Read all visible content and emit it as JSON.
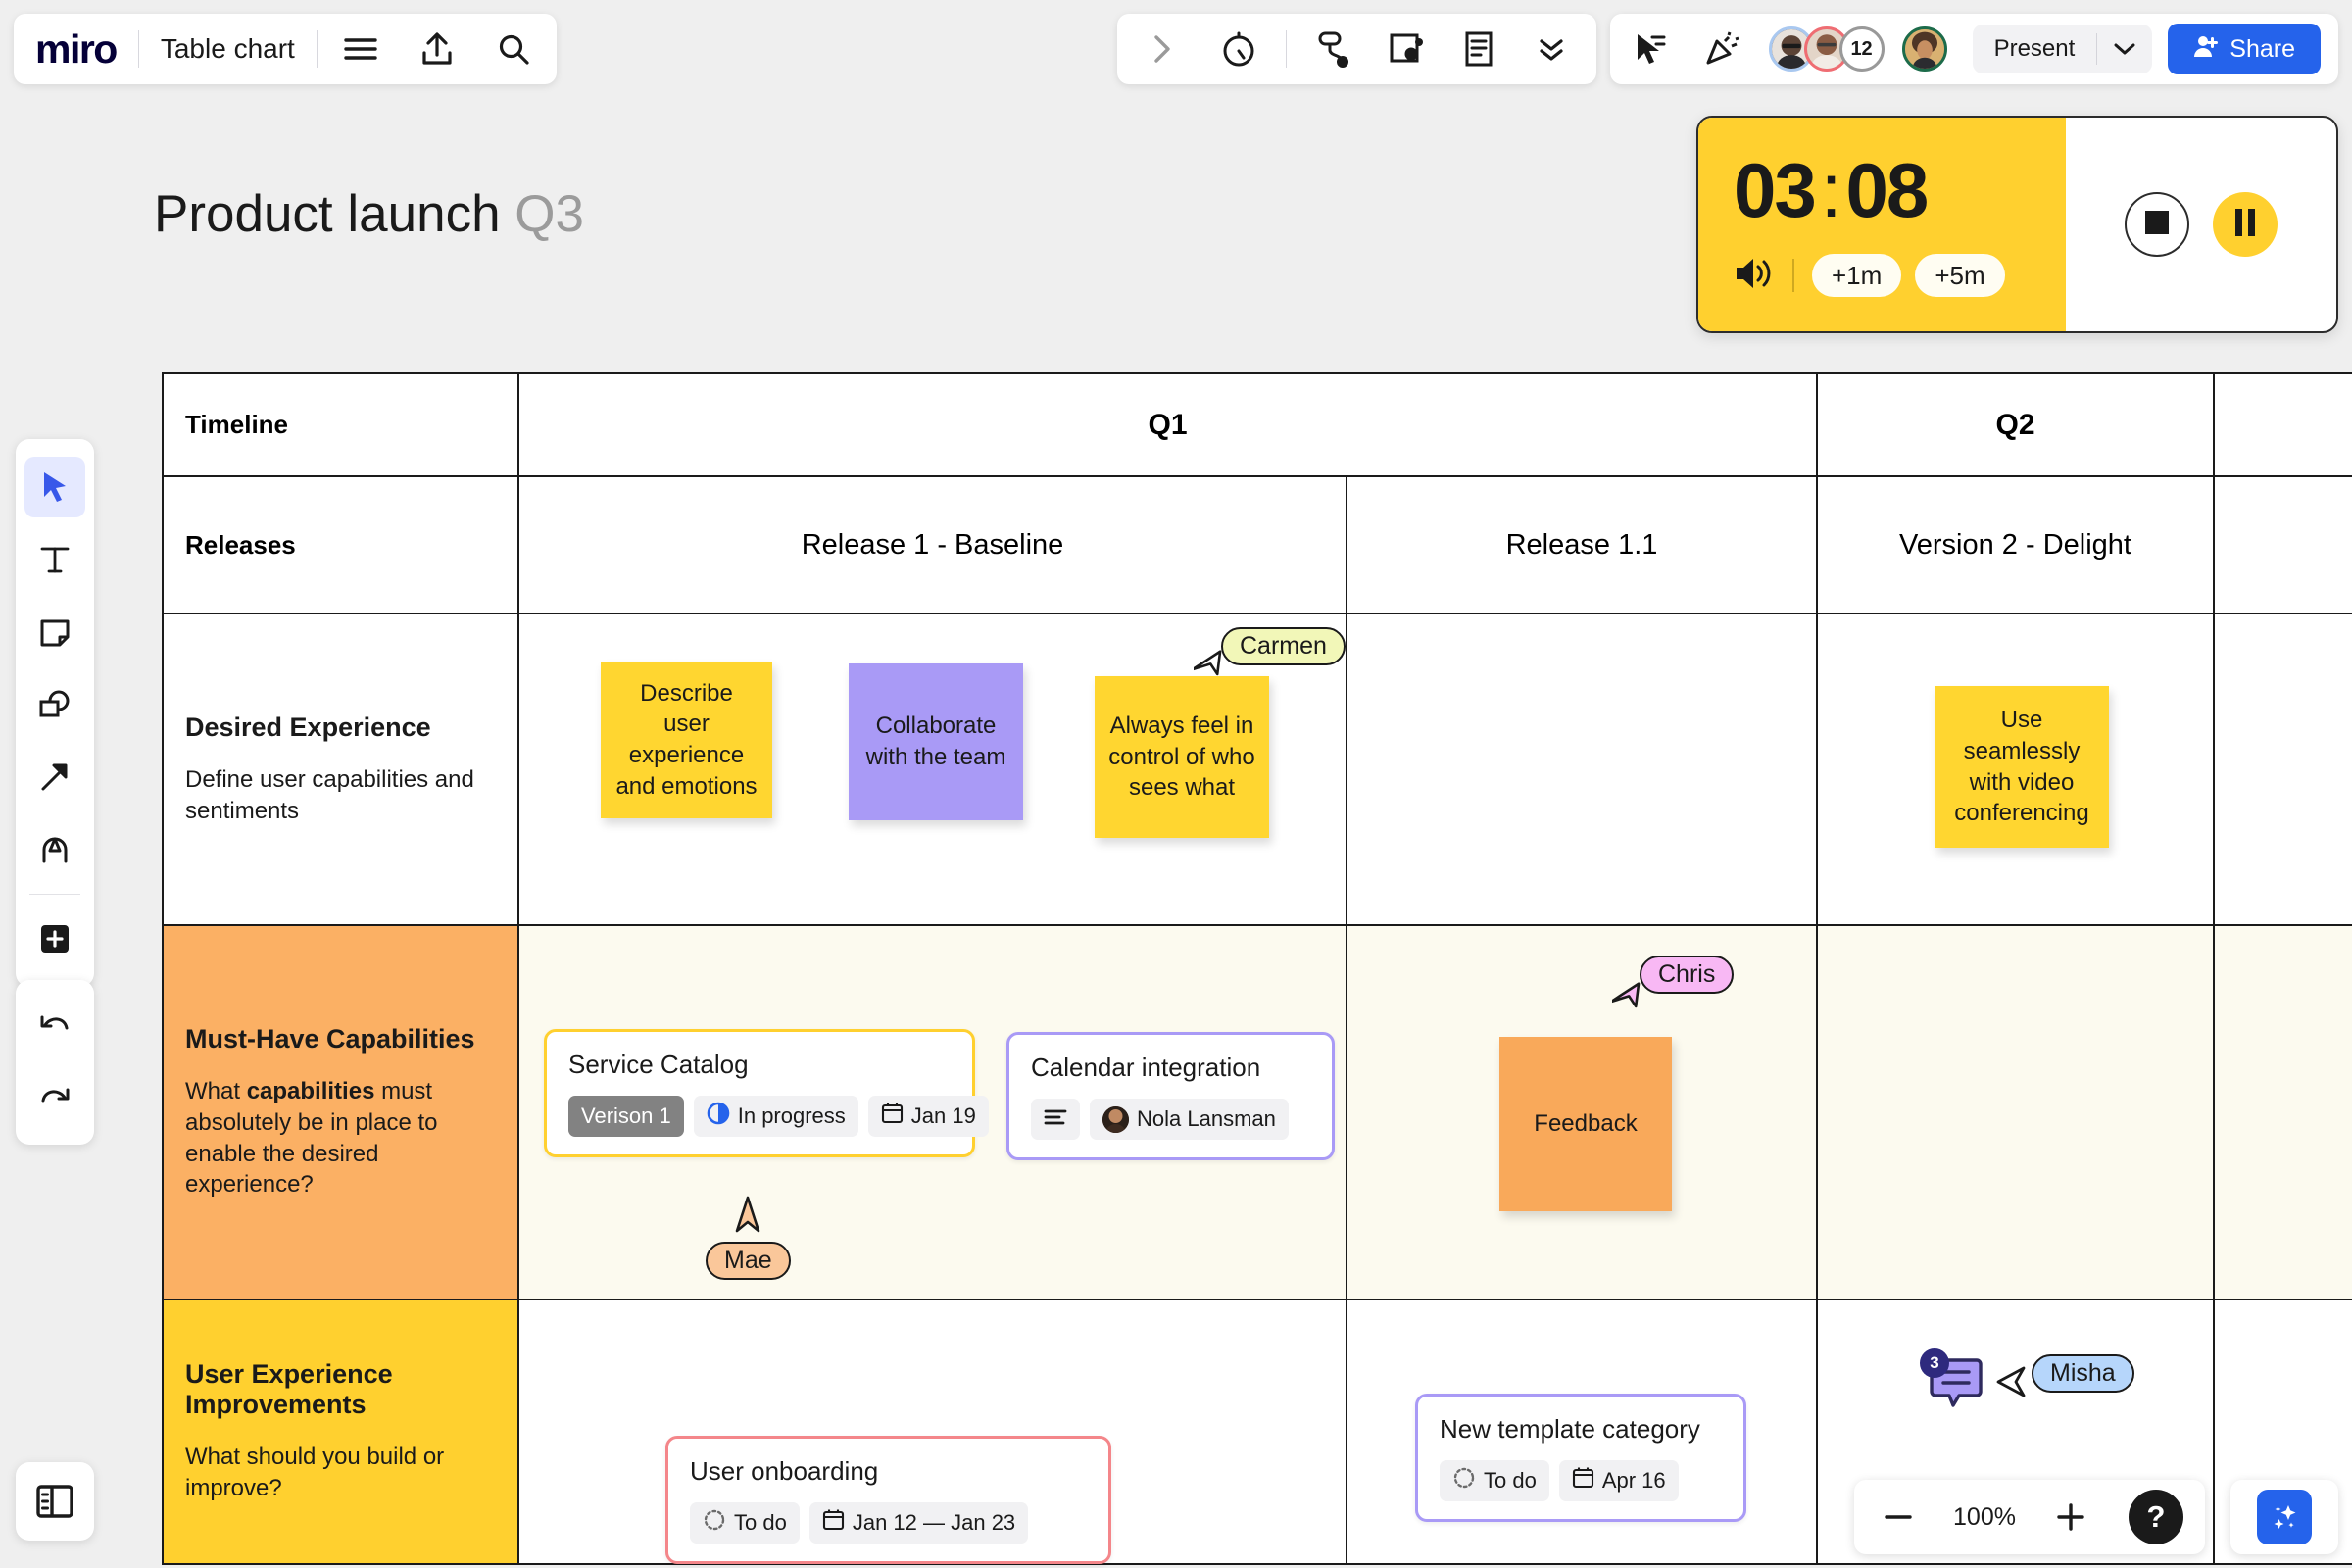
{
  "app": {
    "logo": "miro",
    "board_name": "Table chart",
    "menu_icon": "hamburger-menu-icon",
    "upload_icon": "upload-icon",
    "search_icon": "search-icon"
  },
  "toolbar_center": {
    "items": [
      {
        "name": "expand-chevron-right-icon",
        "label": ">"
      },
      {
        "name": "timer-icon",
        "label": "Timer"
      },
      {
        "name": "voting-icon",
        "label": "Voting"
      },
      {
        "name": "frames-icon",
        "label": "Frames"
      },
      {
        "name": "notes-icon",
        "label": "Notes"
      },
      {
        "name": "more-chevrons-down-icon",
        "label": "More"
      }
    ]
  },
  "toolbar_right": {
    "cursor_chat_icon": "cursor-chat-icon",
    "celebrate_icon": "celebrate-confetti-icon",
    "collaborator_count": "12",
    "present_label": "Present",
    "present_caret_icon": "chevron-down-icon",
    "share_label": "Share",
    "share_icon": "person-add-icon",
    "share_color": "#2563eb"
  },
  "timer": {
    "minutes": "03",
    "separator": ":",
    "seconds": "08",
    "sound_icon": "speaker-volume-icon",
    "add_1m": "+1m",
    "add_5m": "+5m",
    "stop_icon": "stop-square-icon",
    "pause_icon": "pause-icon",
    "accent": "#ffd02f"
  },
  "left_tools": {
    "items": [
      {
        "name": "select-cursor-tool",
        "label": "Select",
        "active": true
      },
      {
        "name": "text-tool",
        "label": "Text",
        "active": false
      },
      {
        "name": "sticky-note-tool",
        "label": "Sticky note",
        "active": false
      },
      {
        "name": "shapes-tool",
        "label": "Shapes",
        "active": false
      },
      {
        "name": "connector-arrow-tool",
        "label": "Connection line",
        "active": false
      },
      {
        "name": "pen-tool",
        "label": "Pen",
        "active": false
      },
      {
        "name": "more-apps-tool",
        "label": "More apps",
        "active": false
      }
    ],
    "undo_label": "Undo",
    "redo_label": "Redo",
    "panel_toggle_label": "Toggle panel"
  },
  "board": {
    "title_main": "Product launch",
    "title_suffix": "Q3"
  },
  "table": {
    "rows": [
      {
        "type": "header",
        "label": "Timeline",
        "cells": [
          {
            "text": "Q1",
            "span": 2
          },
          {
            "text": "Q2",
            "span": 1
          },
          {
            "text": "",
            "span": 1
          }
        ]
      },
      {
        "type": "releases",
        "label": "Releases",
        "cells": [
          {
            "text": "Release 1 - Baseline"
          },
          {
            "text": "Release 1.1"
          },
          {
            "text": "Version 2 - Delight"
          },
          {
            "text": ""
          }
        ]
      },
      {
        "type": "content",
        "label": "Desired Experience",
        "desc": "Define user capabilities and sentiments",
        "label_bg": "#ffffff",
        "row_bg": "#ffffff"
      },
      {
        "type": "content",
        "label": "Must-Have Capabilities",
        "desc_pre": "What ",
        "desc_bold": "capabilities",
        "desc_post": " must absolutely be in place to enable the desired experience?",
        "label_bg": "#fbb064",
        "row_bg": "#fcfaef"
      },
      {
        "type": "content",
        "label": "User Experience Improvements",
        "desc": "What should you build or improve?",
        "label_bg": "#ffd02f",
        "row_bg": "#ffffff"
      }
    ]
  },
  "stickies": [
    {
      "id": "s1",
      "text": "Describe user experience and emotions",
      "color": "#ffd630"
    },
    {
      "id": "s2",
      "text": "Collaborate with the team",
      "color": "#a99af6"
    },
    {
      "id": "s3",
      "text": "Always feel in control of who sees what",
      "color": "#ffd630"
    },
    {
      "id": "s4",
      "text": "Use seamlessly with video conferencing",
      "color": "#ffd630"
    },
    {
      "id": "s5",
      "text": "Feedback",
      "color": "#f9a košice"
    }
  ],
  "cards": [
    {
      "id": "c1",
      "title": "Service Catalog",
      "border": "#ffd02f",
      "chips": [
        {
          "name": "version-chip",
          "text": "Verison 1",
          "icon": null,
          "style": "grey"
        },
        {
          "name": "status-chip",
          "text": "In progress",
          "icon": "half-circle-progress-icon",
          "style": "light"
        },
        {
          "name": "date-chip",
          "text": "Jan 19",
          "icon": "calendar-icon",
          "style": "light"
        }
      ]
    },
    {
      "id": "c2",
      "title": "Calendar integration",
      "border": "#a99af6",
      "chips": [
        {
          "name": "description-chip",
          "text": "",
          "icon": "lines-description-icon",
          "style": "light"
        },
        {
          "name": "assignee-chip",
          "text": "Nola Lansman",
          "icon": "avatar",
          "style": "light"
        }
      ]
    },
    {
      "id": "c3",
      "title": "User onboarding",
      "border": "#f4868a",
      "chips": [
        {
          "name": "status-chip",
          "text": "To do",
          "icon": "dotted-circle-icon",
          "style": "light"
        },
        {
          "name": "date-chip",
          "text": "Jan 12 — Jan 23",
          "icon": "calendar-icon",
          "style": "light"
        }
      ]
    },
    {
      "id": "c4",
      "title": "New template category",
      "border": "#a99af6",
      "chips": [
        {
          "name": "status-chip",
          "text": "To do",
          "icon": "dotted-circle-icon",
          "style": "light"
        },
        {
          "name": "date-chip",
          "text": "Apr 16",
          "icon": "calendar-icon",
          "style": "light"
        }
      ]
    }
  ],
  "cursors": [
    {
      "id": "carmen",
      "name": "Carmen",
      "color": "#f2f7b8"
    },
    {
      "id": "chris",
      "name": "Chris",
      "color": "#f8b8f4"
    },
    {
      "id": "mae",
      "name": "Mae",
      "color": "#fac79a"
    },
    {
      "id": "misha",
      "name": "Misha",
      "color": "#b6d6fb"
    }
  ],
  "comment_badge": {
    "count": "3",
    "icon": "comment-bubble-icon",
    "color": "#a99af6"
  },
  "zoom_controls": {
    "minus_label": "−",
    "level": "100%",
    "plus_label": "+",
    "help_label": "?",
    "ai_icon": "ai-sparkle-icon"
  }
}
